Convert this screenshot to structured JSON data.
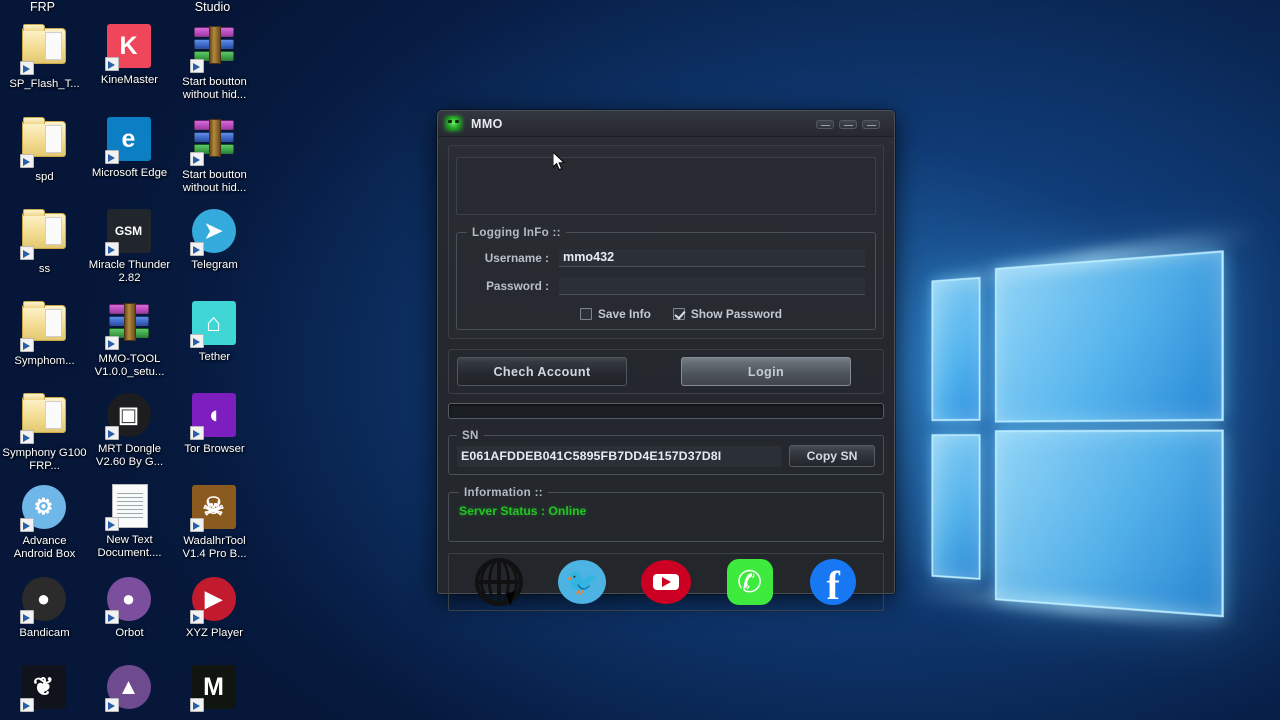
{
  "desktop": {
    "column_headers": [
      {
        "label": "FRP"
      },
      {
        "label": "Studio"
      }
    ],
    "icons": [
      {
        "label": "SP_Flash_T...",
        "icon": "folder-icon",
        "kind": "folder"
      },
      {
        "label": "KineMaster",
        "icon": "kinemaster-icon",
        "kind": "app",
        "color": "#f0465b",
        "glyph": "K"
      },
      {
        "label": "Start boutton without hid...",
        "icon": "winrar-archive-icon",
        "kind": "rar"
      },
      {
        "label": "spd",
        "icon": "folder-icon",
        "kind": "folder"
      },
      {
        "label": "Microsoft Edge",
        "icon": "microsoft-edge-icon",
        "kind": "app",
        "color": "#0b7ec4",
        "glyph": "e"
      },
      {
        "label": "Start boutton without hid...",
        "icon": "winrar-archive-icon",
        "kind": "rar"
      },
      {
        "label": "ss",
        "icon": "folder-icon",
        "kind": "folder"
      },
      {
        "label": "Miracle Thunder 2.82",
        "icon": "miracle-thunder-icon",
        "kind": "app",
        "color": "#20262c",
        "glyph": "GSM"
      },
      {
        "label": "Telegram",
        "icon": "telegram-icon",
        "kind": "round",
        "color": "#35aadc",
        "glyph": "➤"
      },
      {
        "label": "Symphom...",
        "icon": "folder-icon",
        "kind": "folder"
      },
      {
        "label": "MMO-TOOL V1.0.0_setu...",
        "icon": "winrar-archive-icon",
        "kind": "rar"
      },
      {
        "label": "Tether",
        "icon": "tether-icon",
        "kind": "app",
        "color": "#41d6d6",
        "glyph": "⌂"
      },
      {
        "label": "Symphony G100 FRP...",
        "icon": "folder-icon",
        "kind": "folder"
      },
      {
        "label": "MRT Dongle V2.60 By G...",
        "icon": "mrt-dongle-icon",
        "kind": "round",
        "color": "#1d1d1f",
        "glyph": "▣"
      },
      {
        "label": "Tor Browser",
        "icon": "tor-browser-icon",
        "kind": "app",
        "color": "#7c1fbe",
        "glyph": "◖"
      },
      {
        "label": "Advance Android Box",
        "icon": "advance-android-box-icon",
        "kind": "round",
        "color": "#6fb7e8",
        "glyph": "⚙"
      },
      {
        "label": "New Text Document....",
        "icon": "text-document-icon",
        "kind": "doc"
      },
      {
        "label": "WadalhrTool V1.4 Pro B...",
        "icon": "wadalhrtool-icon",
        "kind": "app",
        "color": "#8a5a1e",
        "glyph": "☠"
      },
      {
        "label": "Bandicam",
        "icon": "bandicam-icon",
        "kind": "round",
        "color": "#2b2b2b",
        "glyph": "●"
      },
      {
        "label": "Orbot",
        "icon": "orbot-icon",
        "kind": "round",
        "color": "#7b4f9e",
        "glyph": "●"
      },
      {
        "label": "XYZ Player",
        "icon": "xyz-player-icon",
        "kind": "round",
        "color": "#c21b2e",
        "glyph": "▶"
      },
      {
        "label": "",
        "icon": "dragon-icon",
        "kind": "app",
        "color": "#10131b",
        "glyph": "❦"
      },
      {
        "label": "",
        "icon": "fox-icon",
        "kind": "round",
        "color": "#6e4a8e",
        "glyph": "▲"
      },
      {
        "label": "",
        "icon": "mmo-tool-icon",
        "kind": "app",
        "color": "#101510",
        "glyph": "M"
      }
    ]
  },
  "window": {
    "title": "MMO",
    "app_icon": "mmo-frog-icon",
    "titlebar_buttons": [
      {
        "name": "minimize-button",
        "icon": "minimize-icon"
      },
      {
        "name": "maximize-button",
        "icon": "maximize-icon"
      },
      {
        "name": "close-button",
        "icon": "close-icon"
      }
    ],
    "logging_info": {
      "legend": "Logging InFo ::",
      "username_label": "Username :",
      "username_value": "mmo432",
      "username_placeholder": "",
      "password_label": "Password :",
      "password_value": "",
      "password_placeholder": "",
      "save_info": {
        "label": "Save Info",
        "checked": false
      },
      "show_password": {
        "label": "Show Password",
        "checked": true
      }
    },
    "actions": {
      "check_account_label": "Chech Account",
      "login_label": "Login"
    },
    "progress": {
      "value": 0,
      "max": 100
    },
    "sn": {
      "legend": "SN",
      "value": "E061AFDDEB041C5895FB7DD4E157D37D8I",
      "copy_label": "Copy SN"
    },
    "information": {
      "legend": "Information ::",
      "server_status": "Server Status : Online",
      "status_color": "#22c522"
    },
    "social": [
      {
        "name": "website-icon",
        "label": "Website"
      },
      {
        "name": "twitter-icon",
        "label": "Twitter"
      },
      {
        "name": "youtube-icon",
        "label": "YouTube"
      },
      {
        "name": "whatsapp-icon",
        "label": "WhatsApp"
      },
      {
        "name": "facebook-icon",
        "label": "Facebook"
      }
    ]
  },
  "colors": {
    "window_bg": "#23272c",
    "titlebar": "#2b2f35",
    "accent_green": "#22c522",
    "field_bg": "#2b3036",
    "desktop_blue": "#06305f"
  }
}
